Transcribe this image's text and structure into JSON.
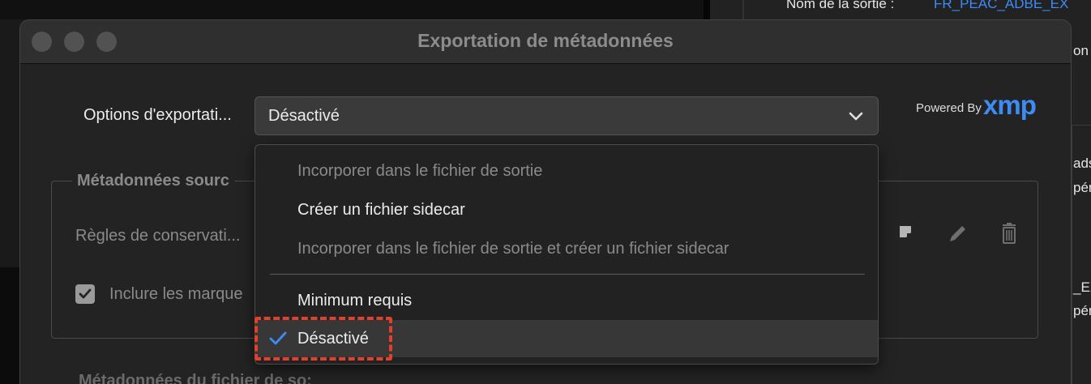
{
  "background": {
    "output_name_label": "Nom de la sortie :",
    "output_name_value": "FR_PEAC_ADBE_EX",
    "right_fragments": [
      "on",
      "ads",
      "pér",
      "_EX",
      "pér"
    ]
  },
  "dialog": {
    "title": "Exportation de métadonnées",
    "export_options_label": "Options d'exportati...",
    "export_options_selected": "Désactivé",
    "powered_by": "Powered By",
    "xmp_logo": "xmp",
    "source_group_title": "Métadonnées sourc",
    "retention_rules_label": "Règles de conservati...",
    "include_markers_label": "Inclure les marque",
    "include_markers_checked": true,
    "source_file_group_title": "Métadonnées du fichier de so:",
    "icons": [
      "new-preset-icon",
      "pencil-icon",
      "trash-icon"
    ]
  },
  "dropdown": {
    "items": [
      {
        "label": "Incorporer dans le fichier de sortie",
        "enabled": false
      },
      {
        "label": "Créer un fichier sidecar",
        "enabled": true
      },
      {
        "label": "Incorporer dans le fichier de sortie et créer un fichier sidecar",
        "enabled": false
      },
      {
        "label": "Minimum requis",
        "enabled": true
      },
      {
        "label": "Désactivé",
        "enabled": true,
        "selected": true
      }
    ]
  },
  "colors": {
    "accent": "#3d8cf5",
    "highlight": "#e0402c"
  }
}
